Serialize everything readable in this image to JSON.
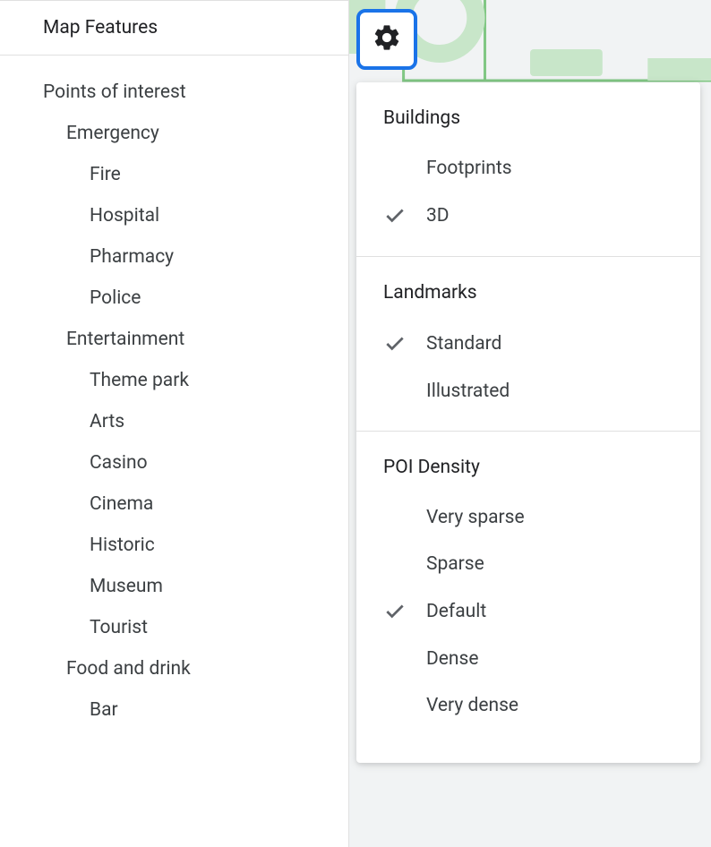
{
  "sidebar": {
    "title": "Map Features",
    "tree": [
      {
        "label": "Points of interest",
        "level": 0
      },
      {
        "label": "Emergency",
        "level": 1
      },
      {
        "label": "Fire",
        "level": 2
      },
      {
        "label": "Hospital",
        "level": 2
      },
      {
        "label": "Pharmacy",
        "level": 2
      },
      {
        "label": "Police",
        "level": 2
      },
      {
        "label": "Entertainment",
        "level": 1
      },
      {
        "label": "Theme park",
        "level": 2
      },
      {
        "label": "Arts",
        "level": 2
      },
      {
        "label": "Casino",
        "level": 2
      },
      {
        "label": "Cinema",
        "level": 2
      },
      {
        "label": "Historic",
        "level": 2
      },
      {
        "label": "Museum",
        "level": 2
      },
      {
        "label": "Tourist",
        "level": 2
      },
      {
        "label": "Food and drink",
        "level": 1
      },
      {
        "label": "Bar",
        "level": 2
      }
    ]
  },
  "dropdown": {
    "sections": [
      {
        "heading": "Buildings",
        "options": [
          {
            "label": "Footprints",
            "checked": false
          },
          {
            "label": "3D",
            "checked": true
          }
        ]
      },
      {
        "heading": "Landmarks",
        "options": [
          {
            "label": "Standard",
            "checked": true
          },
          {
            "label": "Illustrated",
            "checked": false
          }
        ]
      },
      {
        "heading": "POI Density",
        "options": [
          {
            "label": "Very sparse",
            "checked": false
          },
          {
            "label": "Sparse",
            "checked": false
          },
          {
            "label": "Default",
            "checked": true
          },
          {
            "label": "Dense",
            "checked": false
          },
          {
            "label": "Very dense",
            "checked": false
          }
        ]
      }
    ]
  }
}
